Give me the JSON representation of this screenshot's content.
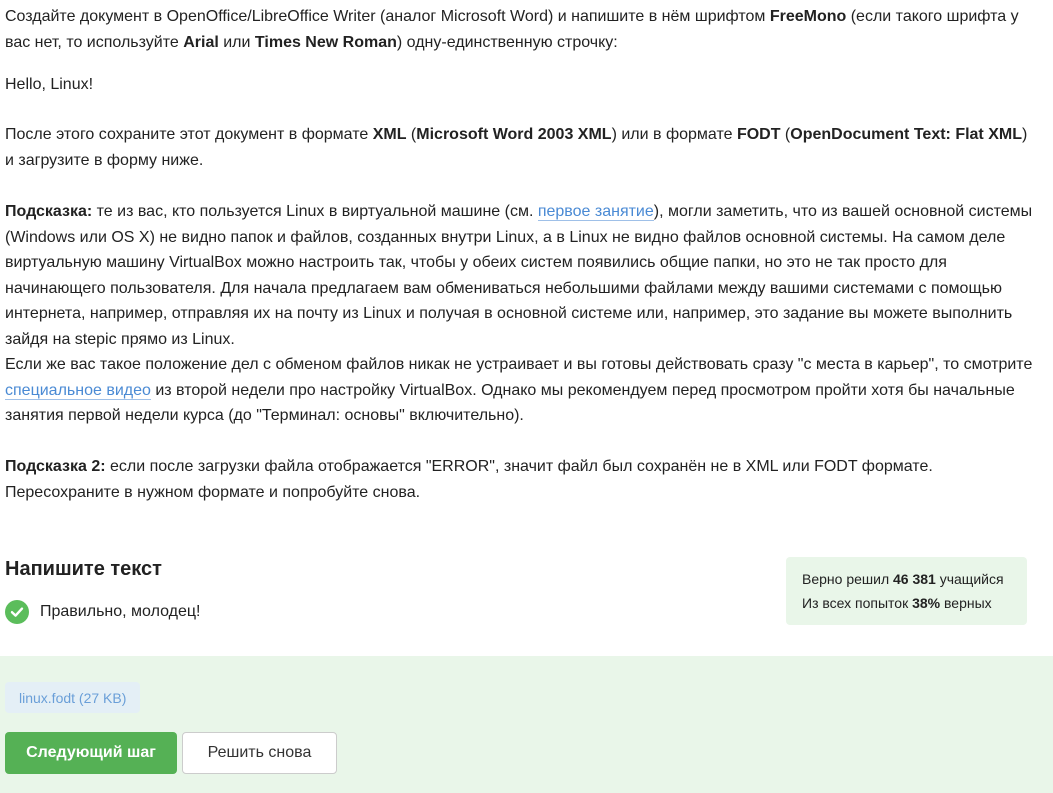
{
  "instructions": {
    "p1": {
      "t1": "Создайте документ в OpenOffice/LibreOffice Writer (аналог Microsoft Word) и напишите в нём шрифтом ",
      "b1": "FreeMono",
      "t2": " (если такого шрифта у вас нет, то используйте ",
      "b2": "Arial",
      "t3": " или ",
      "b3": "Times New Roman",
      "t4": ") одну-единственную строчку:"
    },
    "p2": "Hello, Linux!",
    "p3": {
      "t1": "После этого сохраните этот документ в формате ",
      "b1": "XML",
      "t2": " (",
      "b2": "Microsoft Word 2003 XML",
      "t3": ") или в формате ",
      "b3": "FODT",
      "t4": " (",
      "b4": "OpenDocument Text: Flat XML",
      "t5": ") и загрузите в форму ниже."
    },
    "p4": {
      "b1": "Подсказка:",
      "t1": " те из вас, кто пользуется Linux в виртуальной машине (см. ",
      "link1": "первое занятие",
      "t2": "), могли заметить, что из вашей основной системы (Windows или OS X) не видно папок и файлов, созданных внутри Linux, а в Linux не видно файлов основной системы. На самом деле виртуальную машину VirtualBox можно настроить так, чтобы у обеих систем появились общие папки, но это не так просто для начинающего пользователя. Для начала предлагаем вам обмениваться небольшими файлами между вашими системами с помощью интернета, например, отправляя их на почту из Linux и получая в основной системе или, например, это задание вы можете выполнить зайдя на stepic прямо из Linux."
    },
    "p5": {
      "t1": "Если же вас такое положение дел с обменом файлов никак не устраивает и вы готовы действовать сразу \"с места в карьер\", то смотрите ",
      "link1": "специальное видео",
      "t2": " из второй недели про настройку VirtualBox. Однако мы рекомендуем перед просмотром пройти хотя бы начальные занятия первой недели курса (до \"Терминал: основы\" включительно)."
    },
    "p6": {
      "b1": "Подсказка 2:",
      "t1": " если после загрузки файла отображается \"ERROR\", значит файл был сохранён не в XML или FODT формате. Пересохраните в нужном формате и попробуйте снова."
    }
  },
  "task": {
    "title": "Напишите текст",
    "status_text": "Правильно, молодец!",
    "status_icon": "check-circle-icon"
  },
  "stats": {
    "line1_prefix": "Верно решил ",
    "line1_value": "46 381",
    "line1_suffix": " учащийся",
    "line2_prefix": "Из всех попыток ",
    "line2_value": "38%",
    "line2_suffix": " верных"
  },
  "submission": {
    "file_label": "linux.fodt (27 KB)"
  },
  "buttons": {
    "next_label": "Следующий шаг",
    "retry_label": "Решить снова"
  },
  "colors": {
    "accent_green": "#55b155",
    "panel_green": "#e9f6e9",
    "link_blue": "#4a8ad4"
  }
}
